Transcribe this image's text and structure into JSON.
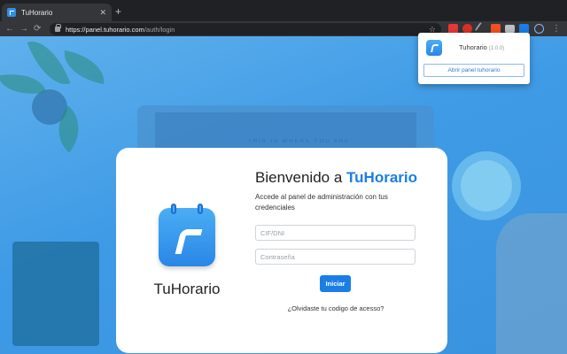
{
  "browser": {
    "tab": {
      "title": "TuHorario",
      "close_glyph": "✕"
    },
    "new_tab_glyph": "+",
    "url": {
      "scheme": "https://",
      "host": "panel.tuhorario.com",
      "path": "/auth/login"
    },
    "nav": {
      "back": "←",
      "forward": "→",
      "reload": "⟳"
    },
    "star_glyph": "☆",
    "menu_glyph": "⋮",
    "extensions": [
      {
        "name": "ext-red-icon",
        "color": "#e53935"
      },
      {
        "name": "ext-red-badge-icon",
        "color": "#d93025"
      },
      {
        "name": "ext-pen-icon",
        "color": "#9aa0a6"
      },
      {
        "name": "ext-orange-icon",
        "color": "#f4511e"
      },
      {
        "name": "ext-briefcase-icon",
        "color": "#bdc1c6"
      },
      {
        "name": "ext-tuhorario-icon",
        "color": "#1a7ee6"
      },
      {
        "name": "ext-square-icon",
        "color": "#8ab4f8"
      }
    ]
  },
  "popup": {
    "title": "Tuhorario",
    "version": "(1.0.0)",
    "button": "Abrir panel tuhorario"
  },
  "login": {
    "brand": "TuHorario",
    "welcome_prefix": "Bienvenido a",
    "welcome_brand": "TuHorario",
    "subtitle": "Accede al panel de administración con tus credenciales",
    "cif_placeholder": "CIF/DNI",
    "password_placeholder": "Contraseña",
    "submit": "Iniciar",
    "forgot": "¿Olvidaste tu codigo de acesso?"
  },
  "background": {
    "laptop_text": "THIS IS WHERE YOU ARE"
  },
  "colors": {
    "accent": "#1a7ee6",
    "background": "#3f9be6"
  }
}
